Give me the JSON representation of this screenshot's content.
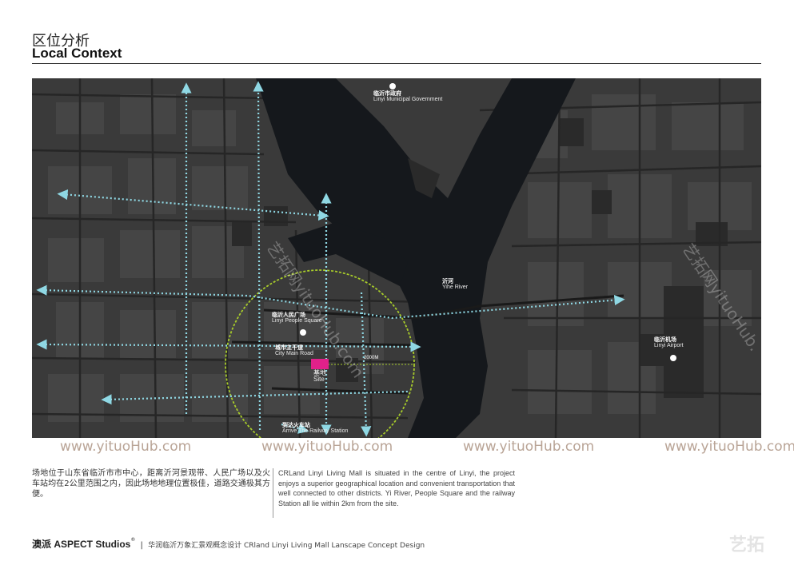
{
  "header": {
    "title_cn": "区位分析",
    "title_en": "Local Context"
  },
  "map": {
    "labels": {
      "government": {
        "cn": "临沂市政府",
        "en": "Linyi Municipal Government"
      },
      "river": {
        "cn": "沂河",
        "en": "Yihe River"
      },
      "people_square": {
        "cn": "临沂人民广场",
        "en": "Linyi People Square"
      },
      "main_road": {
        "cn": "城市主干道",
        "en": "City Main Road"
      },
      "site": {
        "cn": "基地",
        "en": "Site"
      },
      "airport": {
        "cn": "临沂机场",
        "en": "Linyi Airport"
      },
      "railway": {
        "cn": "到达火车站",
        "en": "Arrive The Railway Station"
      }
    },
    "distance_label": "2000M",
    "colors": {
      "background": "#3a3a3a",
      "river": "#15181c",
      "route": "#8fd8e4",
      "road": "#262626",
      "radius_circle": "#a8cc2a",
      "site": "#e0218a"
    }
  },
  "watermarks": {
    "url": "www.yituoHub.com",
    "diagonal": "艺拓网yituoHub.com",
    "diagonal_right": "艺拓网yituoHub.",
    "logo": "艺拓"
  },
  "description": {
    "cn": "场地位于山东省临沂市市中心，距离沂河景观带、人民广场以及火车站均在2公里范围之内，因此场地地理位置极佳，道路交通极其方便。",
    "en": "CRLand Linyi Living Mall is situated in the centre of Linyi, the project enjoys a superior geographical  location and convenient transportation that well connected to other districts. Yi River, People Square and the railway Station all lie within 2km from the site."
  },
  "footer": {
    "brand": "澳派 ASPECT Studios",
    "reg_mark": "®",
    "separator": "|",
    "project": "华润临沂万象汇景观概念设计  CRland Linyi Living Mall Lanscape Concept Design"
  }
}
